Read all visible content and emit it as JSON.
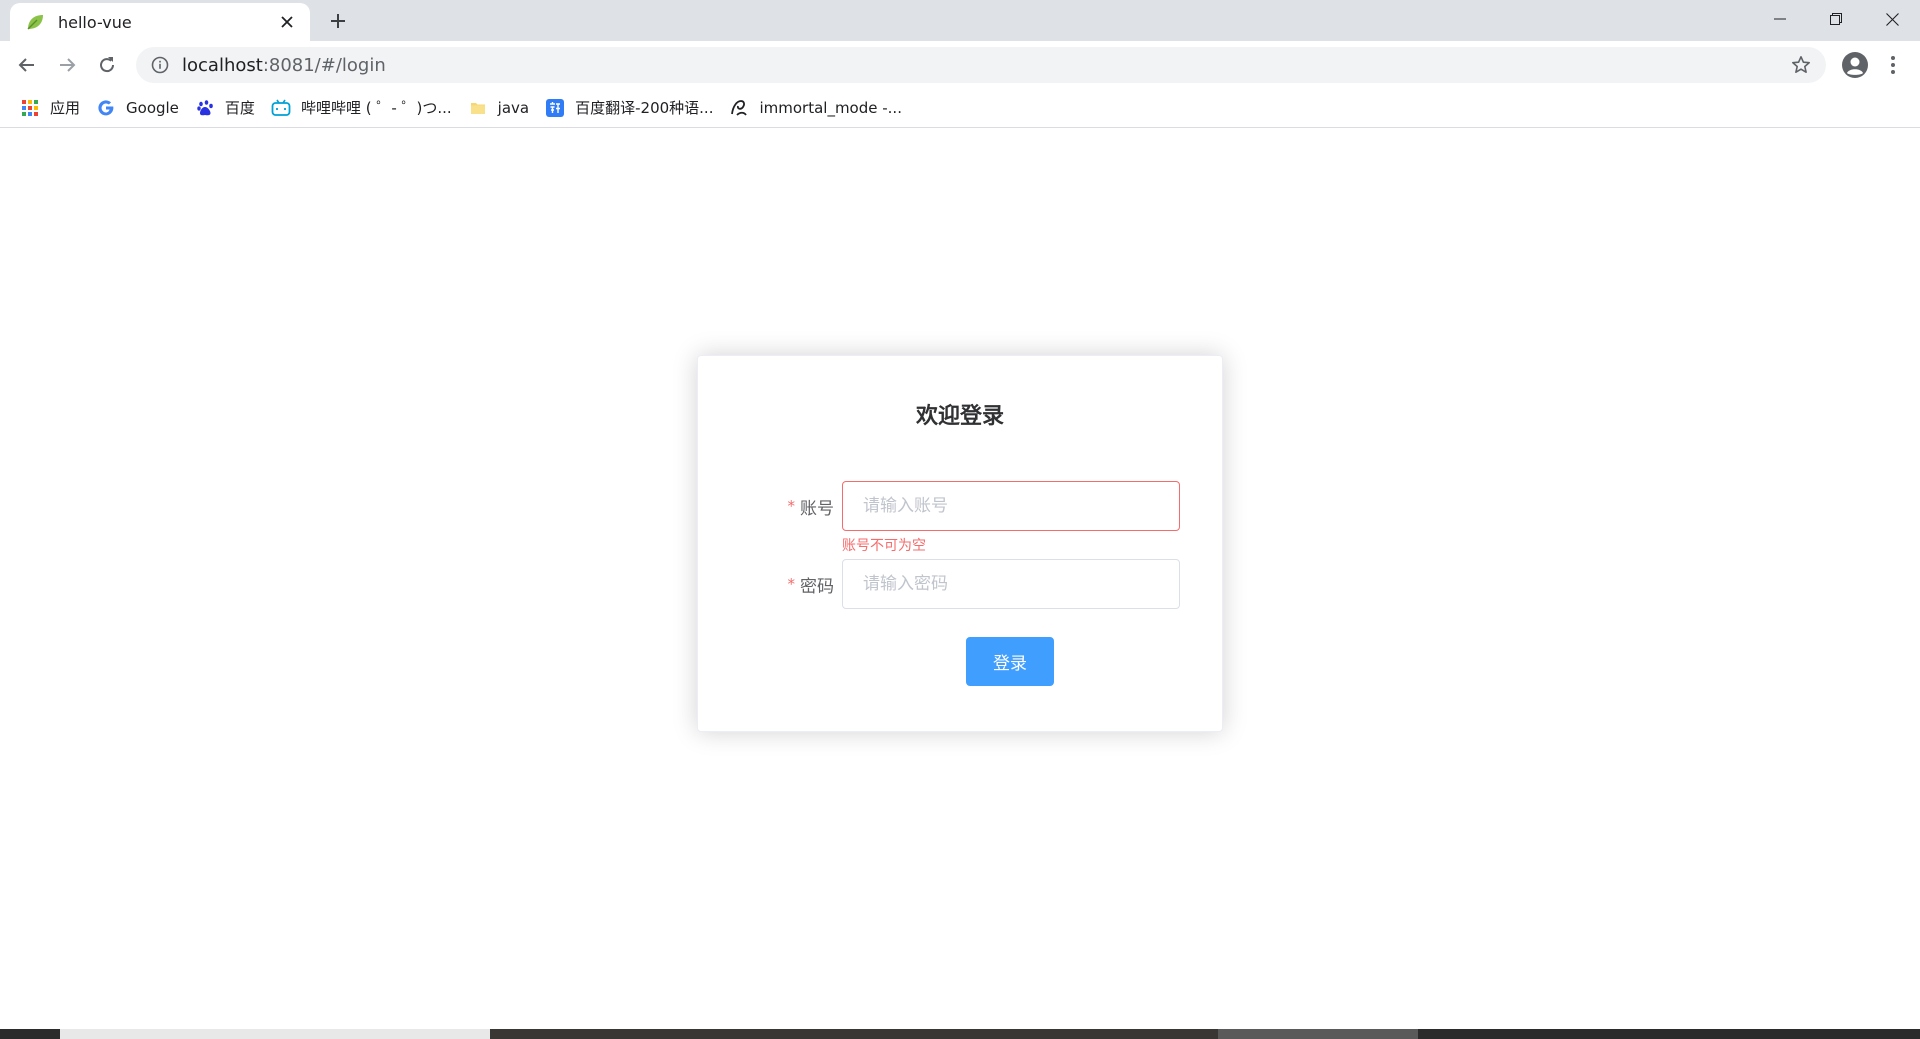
{
  "browser": {
    "tab": {
      "title": "hello-vue",
      "favicon": "vue-leaf-icon"
    },
    "address": {
      "host": "localhost",
      "path": ":8081/#/login"
    },
    "bookmarks": [
      {
        "label": "应用",
        "icon": "apps-grid-icon"
      },
      {
        "label": "Google",
        "icon": "google-g-icon"
      },
      {
        "label": "百度",
        "icon": "baidu-paw-icon"
      },
      {
        "label": "哔哩哔哩 ( ゜- ゜)つ...",
        "icon": "bilibili-tv-icon"
      },
      {
        "label": "java",
        "icon": "folder-icon"
      },
      {
        "label": "百度翻译-200种语...",
        "icon": "translate-icon"
      },
      {
        "label": "immortal_mode -...",
        "icon": "wave-logo-icon"
      }
    ]
  },
  "login": {
    "title": "欢迎登录",
    "account": {
      "label": "账号",
      "placeholder": "请输入账号",
      "error": "账号不可为空"
    },
    "password": {
      "label": "密码",
      "placeholder": "请输入密码"
    },
    "submit_label": "登录",
    "required_mark": "*"
  },
  "colors": {
    "primary": "#409eff",
    "danger": "#f56c6c",
    "tabstrip": "#dee1e6"
  }
}
